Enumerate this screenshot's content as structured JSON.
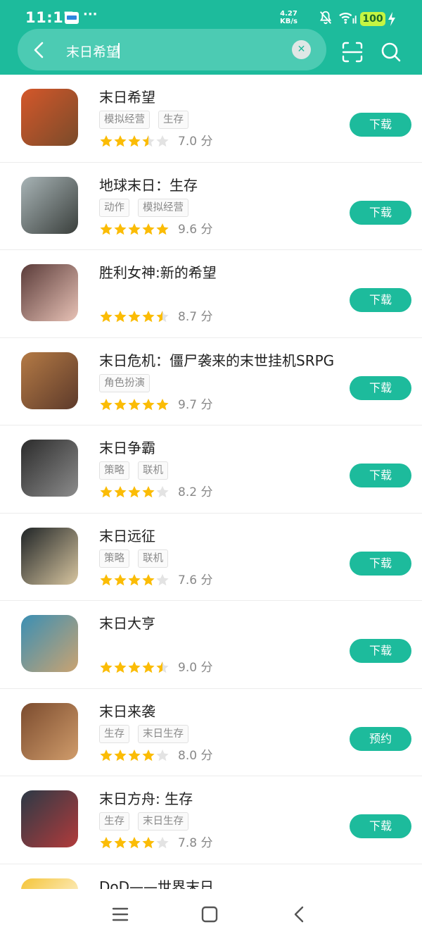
{
  "status_bar": {
    "time": "11:17",
    "net_speed_value": "4.27",
    "net_speed_unit": "KB/s",
    "battery": "100",
    "icons": [
      "notification-app-icon",
      "more-dots-icon",
      "bell-off-icon",
      "wifi-icon",
      "signal-icon",
      "battery-icon",
      "charging-bolt-icon"
    ]
  },
  "search": {
    "query": "末日希望",
    "icons": [
      "back-arrow-icon",
      "clear-icon",
      "scan-icon",
      "search-icon"
    ]
  },
  "colors": {
    "accent": "#1dbb9c",
    "star": "#fbbc05",
    "star_empty": "#e3e3e3"
  },
  "apps": [
    {
      "name": "末日希望",
      "tags": [
        "模拟经营",
        "生存"
      ],
      "rating": 3.5,
      "score": "7.0 分",
      "action": "下载",
      "icon_colors": [
        "#d4572a",
        "#7a4b2a"
      ]
    },
    {
      "name": "地球末日：生存",
      "tags": [
        "动作",
        "模拟经营"
      ],
      "rating": 5,
      "score": "9.6 分",
      "action": "下载",
      "icon_colors": [
        "#a8b4b6",
        "#3a3f3c"
      ]
    },
    {
      "name": "胜利女神:新的希望",
      "tags": [],
      "rating": 4.5,
      "score": "8.7 分",
      "action": "下载",
      "icon_colors": [
        "#5a3b39",
        "#e8c2b6"
      ]
    },
    {
      "name": "末日危机：僵尸袭来的末世挂机SRPG",
      "tags": [
        "角色扮演"
      ],
      "rating": 5,
      "score": "9.7 分",
      "action": "下载",
      "icon_colors": [
        "#b47a45",
        "#5d3a2a"
      ]
    },
    {
      "name": "末日争霸",
      "tags": [
        "策略",
        "联机"
      ],
      "rating": 4,
      "score": "8.2 分",
      "action": "下载",
      "icon_colors": [
        "#2b2b2b",
        "#8c8c8c"
      ]
    },
    {
      "name": "末日远征",
      "tags": [
        "策略",
        "联机"
      ],
      "rating": 4,
      "score": "7.6 分",
      "action": "下载",
      "icon_colors": [
        "#1f2426",
        "#d8c6a0"
      ]
    },
    {
      "name": "末日大亨",
      "tags": [],
      "rating": 4.5,
      "score": "9.0 分",
      "action": "下载",
      "icon_colors": [
        "#3a8fb4",
        "#caa371"
      ]
    },
    {
      "name": "末日来袭",
      "tags": [
        "生存",
        "末日生存"
      ],
      "rating": 4,
      "score": "8.0 分",
      "action": "预约",
      "icon_colors": [
        "#7b4b2e",
        "#d09c6b"
      ]
    },
    {
      "name": "末日方舟: 生存",
      "tags": [
        "生存",
        "末日生存"
      ],
      "rating": 4,
      "score": "7.8 分",
      "action": "下载",
      "icon_colors": [
        "#2b3946",
        "#b23b3b"
      ]
    },
    {
      "name": "DoD——世界末日",
      "tags": [],
      "rating": 0,
      "score": "",
      "action": "",
      "icon_colors": [
        "#f5c53a",
        "#ffffff"
      ]
    }
  ],
  "nav_bar": {
    "icons": [
      "menu-icon",
      "home-icon",
      "back-icon"
    ]
  }
}
